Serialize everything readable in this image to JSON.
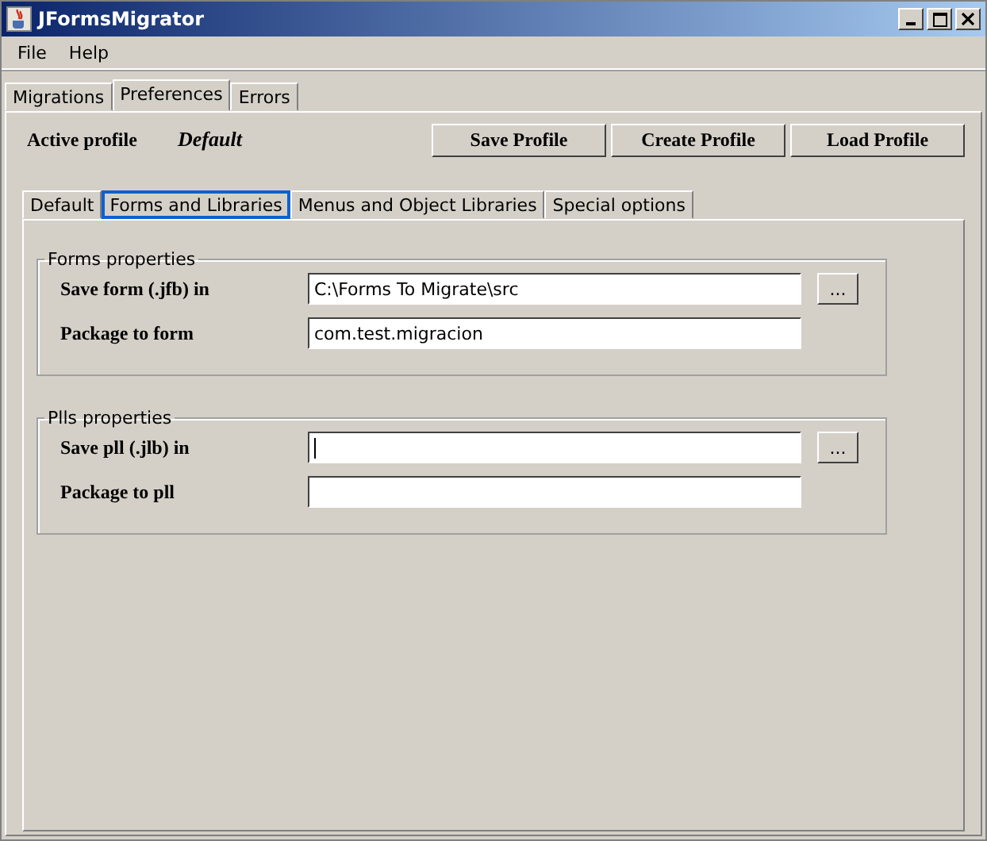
{
  "window": {
    "title": "JFormsMigrator"
  },
  "menu": [
    "File",
    "Help"
  ],
  "tabs": [
    {
      "label": "Migrations",
      "selected": false
    },
    {
      "label": "Preferences",
      "selected": true
    },
    {
      "label": "Errors",
      "selected": false
    }
  ],
  "profile": {
    "label": "Active profile",
    "value": "Default"
  },
  "profile_buttons": [
    "Save Profile",
    "Create Profile",
    "Load Profile"
  ],
  "subtabs": [
    {
      "label": "Default",
      "selected": false
    },
    {
      "label": "Forms and Libraries",
      "selected": true
    },
    {
      "label": "Menus and Object Libraries",
      "selected": false
    },
    {
      "label": "Special options",
      "selected": false
    }
  ],
  "groups": [
    {
      "title": "Forms properties",
      "rows": [
        {
          "label": "Save form (.jfb) in",
          "value": "C:\\Forms To Migrate\\src",
          "browse": "..."
        },
        {
          "label": "Package to form",
          "value": "com.test.migracion"
        }
      ]
    },
    {
      "title": "Plls properties",
      "rows": [
        {
          "label": "Save pll (.jlb) in",
          "value": "",
          "browse": "...",
          "focused": true
        },
        {
          "label": "Package to pll",
          "value": ""
        }
      ]
    }
  ]
}
